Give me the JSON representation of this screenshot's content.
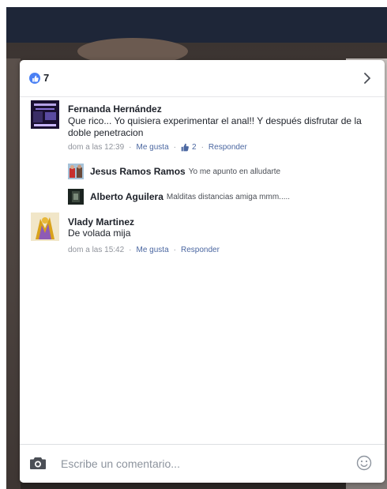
{
  "reactions": {
    "count": "7"
  },
  "comments": [
    {
      "author": "Fernanda Hernández",
      "text": "Que rico... Yo quisiera experimentar el anal!! Y después disfrutar de la doble penetracion",
      "time": "dom a las 12:39",
      "like_label": "Me gusta",
      "like_count": "2",
      "reply_label": "Responder",
      "replies": [
        {
          "author": "Jesus Ramos Ramos",
          "text": "Yo me apunto en alludarte"
        },
        {
          "author": "Alberto Aguilera",
          "text": "Malditas distancias amiga mmm....."
        }
      ]
    },
    {
      "author": "Vlady Martinez",
      "text": "De volada mija",
      "time": "dom a las 15:42",
      "like_label": "Me gusta",
      "reply_label": "Responder"
    }
  ],
  "composer": {
    "placeholder": "Escribe un comentario..."
  },
  "colors": {
    "accent": "#4b67a1",
    "like_blue": "#4a80f4",
    "header_dark": "#1e2638"
  },
  "icons": [
    "like-icon",
    "chevron-right-icon",
    "thumbs-up-icon",
    "camera-icon",
    "emoji-icon"
  ]
}
